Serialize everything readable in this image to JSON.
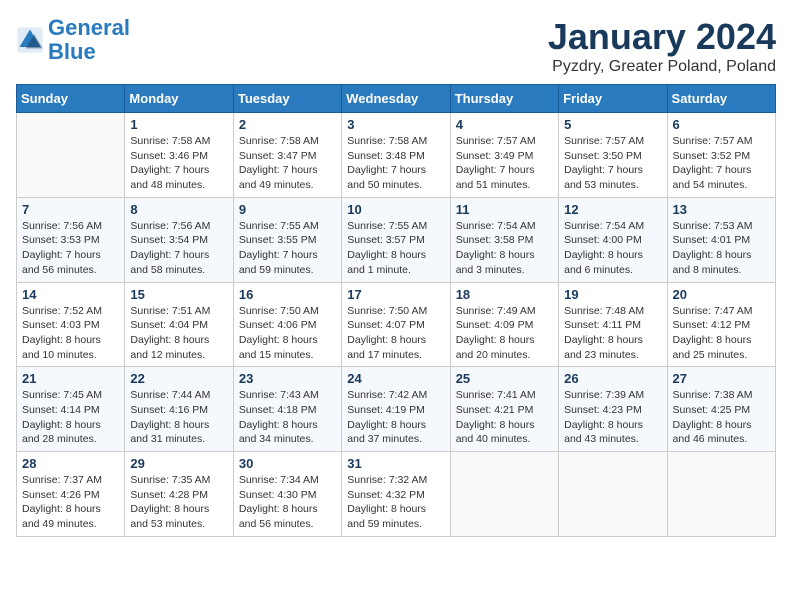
{
  "logo": {
    "text_general": "General",
    "text_blue": "Blue"
  },
  "title": "January 2024",
  "subtitle": "Pyzdry, Greater Poland, Poland",
  "weekdays": [
    "Sunday",
    "Monday",
    "Tuesday",
    "Wednesday",
    "Thursday",
    "Friday",
    "Saturday"
  ],
  "weeks": [
    [
      {
        "day": "",
        "info": ""
      },
      {
        "day": "1",
        "info": "Sunrise: 7:58 AM\nSunset: 3:46 PM\nDaylight: 7 hours\nand 48 minutes."
      },
      {
        "day": "2",
        "info": "Sunrise: 7:58 AM\nSunset: 3:47 PM\nDaylight: 7 hours\nand 49 minutes."
      },
      {
        "day": "3",
        "info": "Sunrise: 7:58 AM\nSunset: 3:48 PM\nDaylight: 7 hours\nand 50 minutes."
      },
      {
        "day": "4",
        "info": "Sunrise: 7:57 AM\nSunset: 3:49 PM\nDaylight: 7 hours\nand 51 minutes."
      },
      {
        "day": "5",
        "info": "Sunrise: 7:57 AM\nSunset: 3:50 PM\nDaylight: 7 hours\nand 53 minutes."
      },
      {
        "day": "6",
        "info": "Sunrise: 7:57 AM\nSunset: 3:52 PM\nDaylight: 7 hours\nand 54 minutes."
      }
    ],
    [
      {
        "day": "7",
        "info": "Sunrise: 7:56 AM\nSunset: 3:53 PM\nDaylight: 7 hours\nand 56 minutes."
      },
      {
        "day": "8",
        "info": "Sunrise: 7:56 AM\nSunset: 3:54 PM\nDaylight: 7 hours\nand 58 minutes."
      },
      {
        "day": "9",
        "info": "Sunrise: 7:55 AM\nSunset: 3:55 PM\nDaylight: 7 hours\nand 59 minutes."
      },
      {
        "day": "10",
        "info": "Sunrise: 7:55 AM\nSunset: 3:57 PM\nDaylight: 8 hours\nand 1 minute."
      },
      {
        "day": "11",
        "info": "Sunrise: 7:54 AM\nSunset: 3:58 PM\nDaylight: 8 hours\nand 3 minutes."
      },
      {
        "day": "12",
        "info": "Sunrise: 7:54 AM\nSunset: 4:00 PM\nDaylight: 8 hours\nand 6 minutes."
      },
      {
        "day": "13",
        "info": "Sunrise: 7:53 AM\nSunset: 4:01 PM\nDaylight: 8 hours\nand 8 minutes."
      }
    ],
    [
      {
        "day": "14",
        "info": "Sunrise: 7:52 AM\nSunset: 4:03 PM\nDaylight: 8 hours\nand 10 minutes."
      },
      {
        "day": "15",
        "info": "Sunrise: 7:51 AM\nSunset: 4:04 PM\nDaylight: 8 hours\nand 12 minutes."
      },
      {
        "day": "16",
        "info": "Sunrise: 7:50 AM\nSunset: 4:06 PM\nDaylight: 8 hours\nand 15 minutes."
      },
      {
        "day": "17",
        "info": "Sunrise: 7:50 AM\nSunset: 4:07 PM\nDaylight: 8 hours\nand 17 minutes."
      },
      {
        "day": "18",
        "info": "Sunrise: 7:49 AM\nSunset: 4:09 PM\nDaylight: 8 hours\nand 20 minutes."
      },
      {
        "day": "19",
        "info": "Sunrise: 7:48 AM\nSunset: 4:11 PM\nDaylight: 8 hours\nand 23 minutes."
      },
      {
        "day": "20",
        "info": "Sunrise: 7:47 AM\nSunset: 4:12 PM\nDaylight: 8 hours\nand 25 minutes."
      }
    ],
    [
      {
        "day": "21",
        "info": "Sunrise: 7:45 AM\nSunset: 4:14 PM\nDaylight: 8 hours\nand 28 minutes."
      },
      {
        "day": "22",
        "info": "Sunrise: 7:44 AM\nSunset: 4:16 PM\nDaylight: 8 hours\nand 31 minutes."
      },
      {
        "day": "23",
        "info": "Sunrise: 7:43 AM\nSunset: 4:18 PM\nDaylight: 8 hours\nand 34 minutes."
      },
      {
        "day": "24",
        "info": "Sunrise: 7:42 AM\nSunset: 4:19 PM\nDaylight: 8 hours\nand 37 minutes."
      },
      {
        "day": "25",
        "info": "Sunrise: 7:41 AM\nSunset: 4:21 PM\nDaylight: 8 hours\nand 40 minutes."
      },
      {
        "day": "26",
        "info": "Sunrise: 7:39 AM\nSunset: 4:23 PM\nDaylight: 8 hours\nand 43 minutes."
      },
      {
        "day": "27",
        "info": "Sunrise: 7:38 AM\nSunset: 4:25 PM\nDaylight: 8 hours\nand 46 minutes."
      }
    ],
    [
      {
        "day": "28",
        "info": "Sunrise: 7:37 AM\nSunset: 4:26 PM\nDaylight: 8 hours\nand 49 minutes."
      },
      {
        "day": "29",
        "info": "Sunrise: 7:35 AM\nSunset: 4:28 PM\nDaylight: 8 hours\nand 53 minutes."
      },
      {
        "day": "30",
        "info": "Sunrise: 7:34 AM\nSunset: 4:30 PM\nDaylight: 8 hours\nand 56 minutes."
      },
      {
        "day": "31",
        "info": "Sunrise: 7:32 AM\nSunset: 4:32 PM\nDaylight: 8 hours\nand 59 minutes."
      },
      {
        "day": "",
        "info": ""
      },
      {
        "day": "",
        "info": ""
      },
      {
        "day": "",
        "info": ""
      }
    ]
  ]
}
